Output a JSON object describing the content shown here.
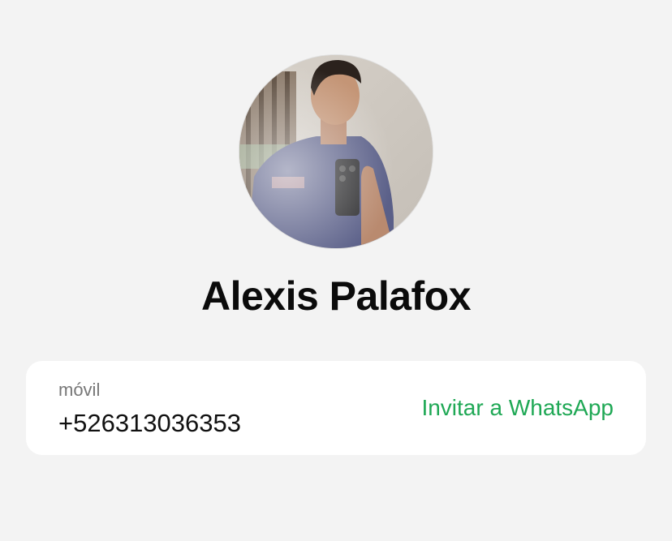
{
  "contact": {
    "name": "Alexis Palafox",
    "avatar_icon": "profile-photo"
  },
  "phone": {
    "label": "móvil",
    "number": "+526313036353",
    "invite_label": "Invitar a WhatsApp"
  },
  "colors": {
    "background": "#f3f3f3",
    "card": "#ffffff",
    "accent": "#1fa855",
    "name_text": "#0b0b0b",
    "label_text": "#777777"
  }
}
